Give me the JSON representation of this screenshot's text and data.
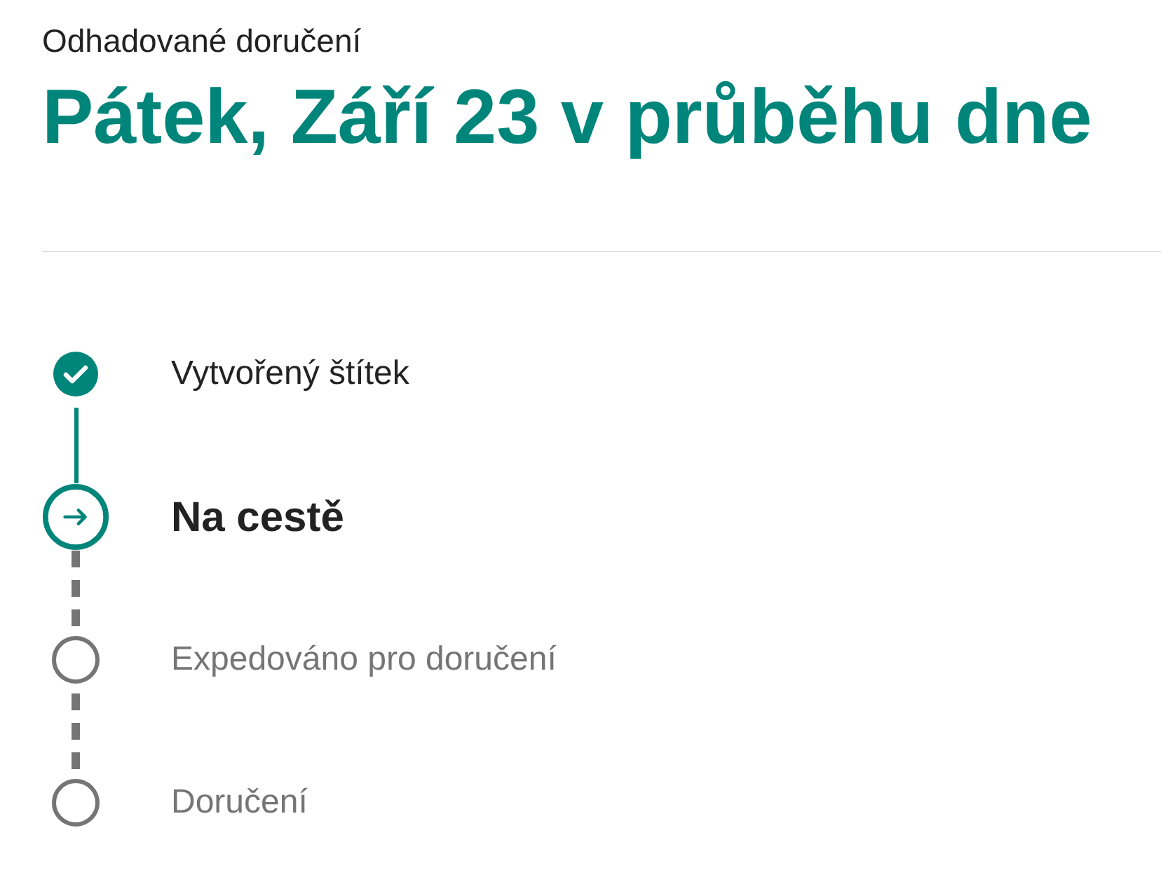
{
  "delivery": {
    "label": "Odhadované doručení",
    "date": "Pátek, Září 23 v průběhu dne"
  },
  "steps": [
    {
      "label": "Vytvořený štítek",
      "kind": "done"
    },
    {
      "label": "Na cestě",
      "kind": "current"
    },
    {
      "label": "Expedováno pro doručení",
      "kind": "pending"
    },
    {
      "label": "Doručení",
      "kind": "pending"
    }
  ]
}
